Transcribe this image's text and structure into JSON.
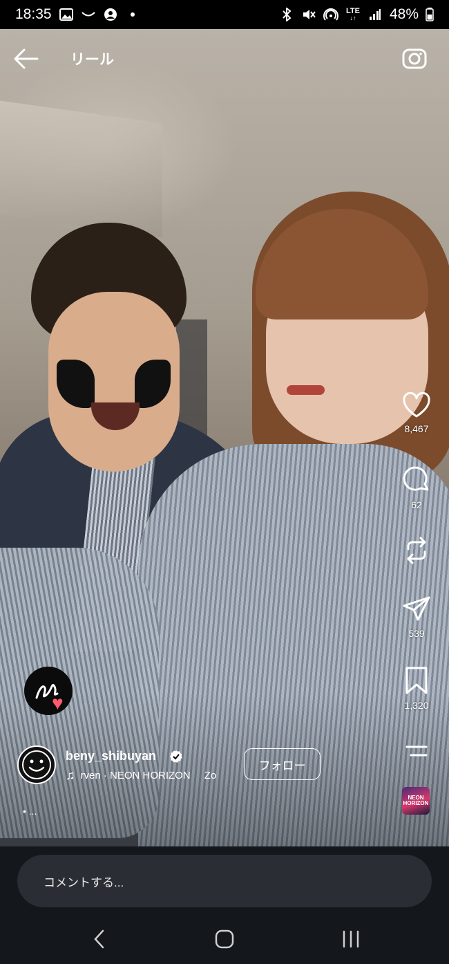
{
  "status_bar": {
    "time": "18:35",
    "battery": "48%",
    "network": "LTE",
    "left_icons": [
      "gallery-icon",
      "smile-icon",
      "account-icon",
      "dot-icon"
    ],
    "right_icons": [
      "bluetooth-icon",
      "mute-icon",
      "hotspot-icon",
      "lte-icon",
      "signal-icon",
      "battery-icon"
    ]
  },
  "header": {
    "title": "リール"
  },
  "actions": {
    "likes": "8,467",
    "comments": "62",
    "repost": "",
    "shares": "539",
    "saves": "1,320"
  },
  "author": {
    "username": "beny_shibuyan",
    "music_track": "rven · NEON HORIZON",
    "music_more": "Zo",
    "follow_label": "フォロー"
  },
  "caption": {
    "more": "• ..."
  },
  "audio_thumb": {
    "label": "NEON HORIZON"
  },
  "comment_bar": {
    "placeholder": "コメントする..."
  },
  "colors": {
    "accent_heart": "#ff5a6e",
    "verified": "#ffffff",
    "bar_background": "#14171c",
    "input_background": "#2a2e34"
  }
}
